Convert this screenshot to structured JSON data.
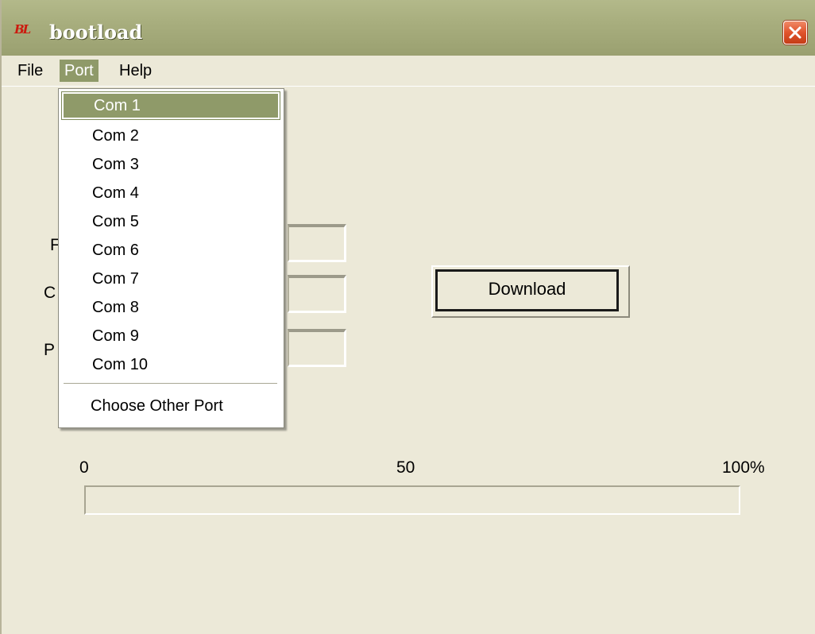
{
  "window": {
    "title": "bootload",
    "icon": "bl-app-icon"
  },
  "menu": [
    {
      "label": "File",
      "active": false
    },
    {
      "label": "Port",
      "active": true
    },
    {
      "label": "Help",
      "active": false
    }
  ],
  "port_menu": {
    "items": [
      "Com 1",
      "Com 2",
      "Com 3",
      "Com 4",
      "Com 5",
      "Com 6",
      "Com 7",
      "Com 8",
      "Com 9",
      "Com 10"
    ],
    "selected": "Com 1",
    "other": "Choose Other Port"
  },
  "fields": [
    {
      "label": "F",
      "value": ""
    },
    {
      "label": "C",
      "value": ""
    },
    {
      "label": "P",
      "value": ""
    }
  ],
  "download_label": "Download",
  "progress": {
    "scale": [
      "0",
      "50",
      "100%"
    ],
    "percent": 0
  },
  "colors": {
    "selection": "#8f9a69",
    "titlebar": "#a8ae7e",
    "close": "#e0532c",
    "background": "#ece9d8"
  }
}
